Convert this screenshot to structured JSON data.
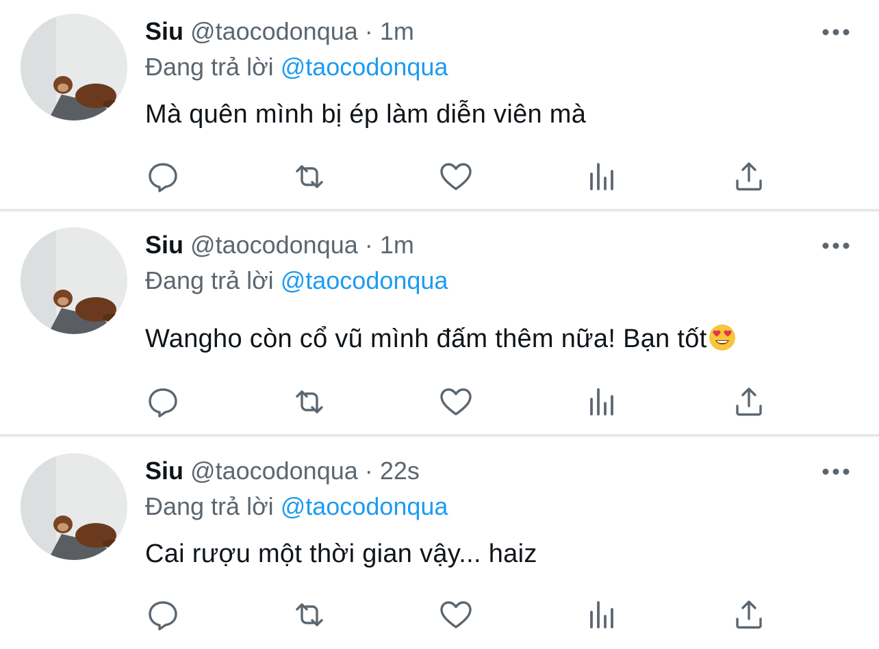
{
  "tweets": [
    {
      "author_name": "Siu",
      "handle": "@taocodonqua",
      "separator": "·",
      "time": "1m",
      "reply_prefix": "Đang trả lời",
      "reply_to": "@taocodonqua",
      "text": "Mà quên mình bị ép làm diễn viên mà",
      "emoji": ""
    },
    {
      "author_name": "Siu",
      "handle": "@taocodonqua",
      "separator": "·",
      "time": "1m",
      "reply_prefix": "Đang trả lời",
      "reply_to": "@taocodonqua",
      "text": "Wangho còn cổ vũ mình đấm thêm nữa! Bạn tốt",
      "emoji": "heart-eyes-emoji"
    },
    {
      "author_name": "Siu",
      "handle": "@taocodonqua",
      "separator": "·",
      "time": "22s",
      "reply_prefix": "Đang trả lời",
      "reply_to": "@taocodonqua",
      "text": "Cai rượu một thời gian vậy... haiz",
      "emoji": ""
    }
  ],
  "icons": {
    "reply": "reply-icon",
    "retweet": "retweet-icon",
    "like": "heart-icon",
    "stats": "stats-icon",
    "share": "share-icon",
    "more": "more-icon"
  },
  "colors": {
    "accent": "#1d9bf0",
    "secondary_text": "#5b6670",
    "primary_text": "#0f1419",
    "icon": "#5b6670",
    "divider": "#e6e9ec"
  }
}
